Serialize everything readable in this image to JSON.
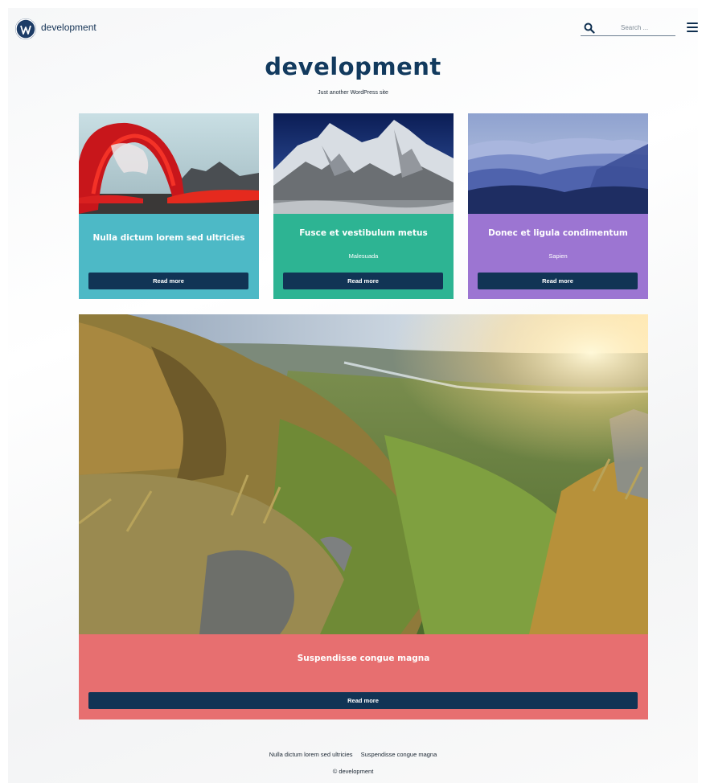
{
  "header": {
    "site_name": "development",
    "logo_icon": "wordpress-logo-icon",
    "search": {
      "placeholder": "Search ...",
      "value": "",
      "icon": "search-icon"
    },
    "menu_icon": "hamburger-menu-icon"
  },
  "branding": {
    "title": "development",
    "tagline": "Just another WordPress site"
  },
  "cards": [
    {
      "title": "Nulla dictum lorem sed ultricies",
      "subtitle": "",
      "button": "Read more",
      "color": "#4db9c6",
      "image": "red-lava-arch-photo"
    },
    {
      "title": "Fusce et vestibulum metus",
      "subtitle": "Malesuada",
      "button": "Read more",
      "color": "#2db493",
      "image": "snowy-mountain-photo"
    },
    {
      "title": "Donec et ligula condimentum",
      "subtitle": "Sapien",
      "button": "Read more",
      "color": "#9c75d2",
      "image": "blue-misty-mountains-photo"
    }
  ],
  "feature": {
    "title": "Suspendisse congue magna",
    "button": "Read more",
    "color": "#e76f70",
    "image": "green-valley-sunrise-photo"
  },
  "footer": {
    "links": [
      "Nulla dictum lorem sed ultricies",
      "Suspendisse congue magna"
    ],
    "copyright": "© development"
  },
  "colors": {
    "navy": "#113455",
    "title": "#123a5e"
  }
}
